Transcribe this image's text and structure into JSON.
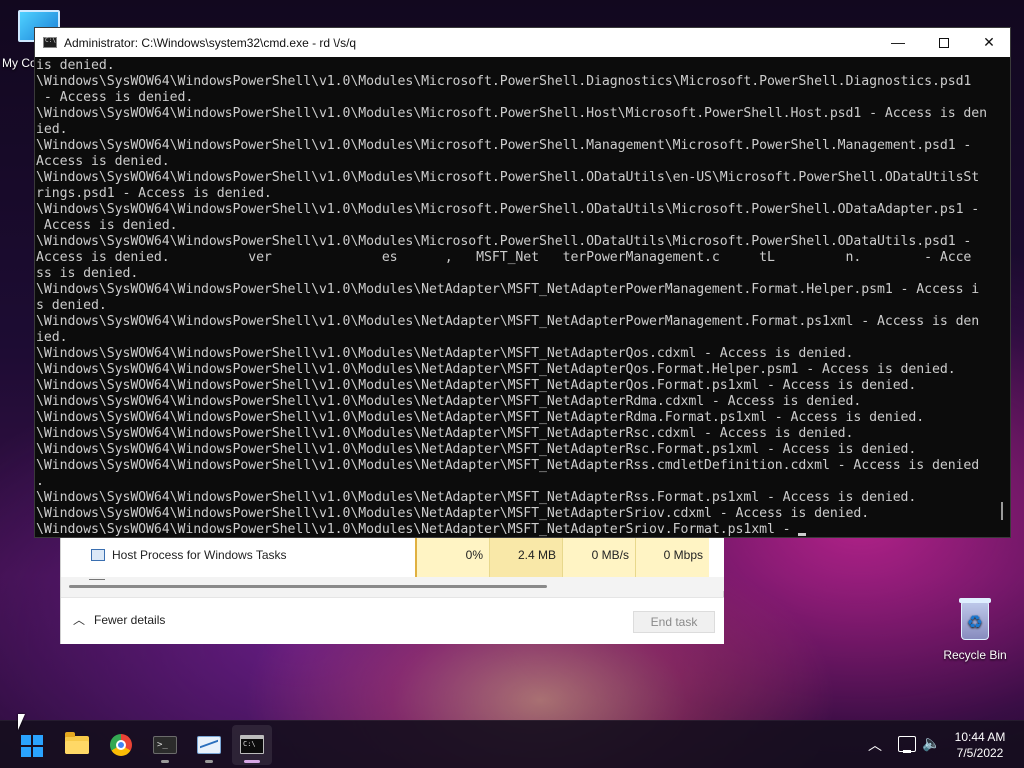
{
  "desktop": {
    "icons": [
      {
        "label": "My Co"
      },
      {
        "label": "Recycle Bin"
      }
    ]
  },
  "task_manager": {
    "process_name": "Host Process for Windows Tasks",
    "cpu": "0%",
    "memory": "2.4 MB",
    "disk": "0 MB/s",
    "network": "0 Mbps",
    "fewer_details": "Fewer details",
    "end_task": "End task"
  },
  "cmd": {
    "title": "Administrator: C:\\Windows\\system32\\cmd.exe - rd \\/s/q",
    "output": "is denied.\n\\Windows\\SysWOW64\\WindowsPowerShell\\v1.0\\Modules\\Microsoft.PowerShell.Diagnostics\\Microsoft.PowerShell.Diagnostics.psd1\n - Access is denied.\n\\Windows\\SysWOW64\\WindowsPowerShell\\v1.0\\Modules\\Microsoft.PowerShell.Host\\Microsoft.PowerShell.Host.psd1 - Access is den\nied.\n\\Windows\\SysWOW64\\WindowsPowerShell\\v1.0\\Modules\\Microsoft.PowerShell.Management\\Microsoft.PowerShell.Management.psd1 -\nAccess is denied.\n\\Windows\\SysWOW64\\WindowsPowerShell\\v1.0\\Modules\\Microsoft.PowerShell.ODataUtils\\en-US\\Microsoft.PowerShell.ODataUtilsSt\nrings.psd1 - Access is denied.\n\\Windows\\SysWOW64\\WindowsPowerShell\\v1.0\\Modules\\Microsoft.PowerShell.ODataUtils\\Microsoft.PowerShell.ODataAdapter.ps1 -\n Access is denied.\n\\Windows\\SysWOW64\\WindowsPowerShell\\v1.0\\Modules\\Microsoft.PowerShell.ODataUtils\\Microsoft.PowerShell.ODataUtils.psd1 -\nAccess is denied.          ver              es      ,   MSFT_Net   terPowerManagement.c     tL         n.        - Acce\nss is denied.\n\\Windows\\SysWOW64\\WindowsPowerShell\\v1.0\\Modules\\NetAdapter\\MSFT_NetAdapterPowerManagement.Format.Helper.psm1 - Access i\ns denied.\n\\Windows\\SysWOW64\\WindowsPowerShell\\v1.0\\Modules\\NetAdapter\\MSFT_NetAdapterPowerManagement.Format.ps1xml - Access is den\nied.\n\\Windows\\SysWOW64\\WindowsPowerShell\\v1.0\\Modules\\NetAdapter\\MSFT_NetAdapterQos.cdxml - Access is denied.\n\\Windows\\SysWOW64\\WindowsPowerShell\\v1.0\\Modules\\NetAdapter\\MSFT_NetAdapterQos.Format.Helper.psm1 - Access is denied.\n\\Windows\\SysWOW64\\WindowsPowerShell\\v1.0\\Modules\\NetAdapter\\MSFT_NetAdapterQos.Format.ps1xml - Access is denied.\n\\Windows\\SysWOW64\\WindowsPowerShell\\v1.0\\Modules\\NetAdapter\\MSFT_NetAdapterRdma.cdxml - Access is denied.\n\\Windows\\SysWOW64\\WindowsPowerShell\\v1.0\\Modules\\NetAdapter\\MSFT_NetAdapterRdma.Format.ps1xml - Access is denied.\n\\Windows\\SysWOW64\\WindowsPowerShell\\v1.0\\Modules\\NetAdapter\\MSFT_NetAdapterRsc.cdxml - Access is denied.\n\\Windows\\SysWOW64\\WindowsPowerShell\\v1.0\\Modules\\NetAdapter\\MSFT_NetAdapterRsc.Format.ps1xml - Access is denied.\n\\Windows\\SysWOW64\\WindowsPowerShell\\v1.0\\Modules\\NetAdapter\\MSFT_NetAdapterRss.cmdletDefinition.cdxml - Access is denied\n.\n\\Windows\\SysWOW64\\WindowsPowerShell\\v1.0\\Modules\\NetAdapter\\MSFT_NetAdapterRss.Format.ps1xml - Access is denied.\n\\Windows\\SysWOW64\\WindowsPowerShell\\v1.0\\Modules\\NetAdapter\\MSFT_NetAdapterSriov.cdxml - Access is denied.\n\\Windows\\SysWOW64\\WindowsPowerShell\\v1.0\\Modules\\NetAdapter\\MSFT_NetAdapterSriov.Format.ps1xml - "
  },
  "taskbar": {
    "apps": [
      {
        "icon": "windows-start-icon"
      },
      {
        "icon": "file-explorer-icon"
      },
      {
        "icon": "chrome-icon"
      },
      {
        "icon": "terminal-icon"
      },
      {
        "icon": "performance-monitor-icon"
      },
      {
        "icon": "command-prompt-icon",
        "active": true
      }
    ],
    "clock": {
      "time": "10:44 AM",
      "date": "7/5/2022"
    }
  },
  "colors": {
    "console_bg": "#0c0c0c",
    "console_fg": "#cccccc",
    "accent": "#2aa3ff"
  }
}
